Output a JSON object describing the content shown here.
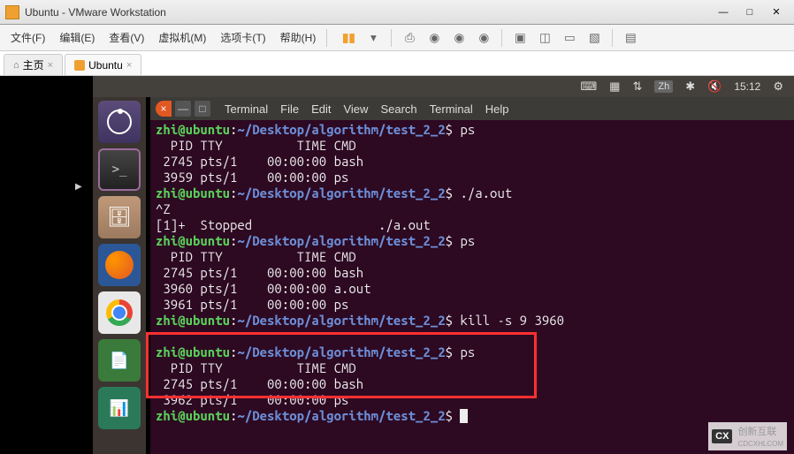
{
  "windows": {
    "title": "Ubuntu - VMware Workstation"
  },
  "vmware": {
    "menu": [
      {
        "label": "文件(F)",
        "u": "F"
      },
      {
        "label": "编辑(E)",
        "u": "E"
      },
      {
        "label": "查看(V)",
        "u": "V"
      },
      {
        "label": "虚拟机(M)",
        "u": "M"
      },
      {
        "label": "选项卡(T)",
        "u": "T"
      },
      {
        "label": "帮助(H)",
        "u": "H"
      }
    ],
    "tabs": {
      "home": "主页",
      "ubuntu": "Ubuntu"
    }
  },
  "ubuntu_panel": {
    "lang": "Zh",
    "time": "15:12"
  },
  "terminal": {
    "menu": [
      "Terminal",
      "File",
      "Edit",
      "View",
      "Search",
      "Terminal",
      "Help"
    ],
    "prompt_user": "zhi@ubuntu",
    "prompt_path": "~/Desktop/algorithm/test_2_2",
    "lines": [
      {
        "type": "prompt",
        "cmd": "ps"
      },
      {
        "type": "out",
        "text": "  PID TTY          TIME CMD"
      },
      {
        "type": "out",
        "text": " 2745 pts/1    00:00:00 bash"
      },
      {
        "type": "out",
        "text": " 3959 pts/1    00:00:00 ps"
      },
      {
        "type": "prompt",
        "cmd": "./a.out"
      },
      {
        "type": "out",
        "text": "^Z"
      },
      {
        "type": "out",
        "text": "[1]+  Stopped                 ./a.out"
      },
      {
        "type": "prompt",
        "cmd": "ps"
      },
      {
        "type": "out",
        "text": "  PID TTY          TIME CMD"
      },
      {
        "type": "out",
        "text": " 2745 pts/1    00:00:00 bash"
      },
      {
        "type": "out",
        "text": " 3960 pts/1    00:00:00 a.out"
      },
      {
        "type": "out",
        "text": " 3961 pts/1    00:00:00 ps"
      },
      {
        "type": "prompt",
        "cmd": "kill -s 9 3960"
      },
      {
        "type": "out",
        "text": ""
      },
      {
        "type": "prompt",
        "cmd": "ps"
      },
      {
        "type": "out",
        "text": "  PID TTY          TIME CMD"
      },
      {
        "type": "out",
        "text": " 2745 pts/1    00:00:00 bash"
      },
      {
        "type": "out",
        "text": " 3962 pts/1    00:00:00 ps"
      },
      {
        "type": "prompt",
        "cmd": ""
      }
    ]
  },
  "watermark": {
    "brand": "创新互联",
    "sub": "CDCXHLCOM",
    "icon": "CX"
  }
}
